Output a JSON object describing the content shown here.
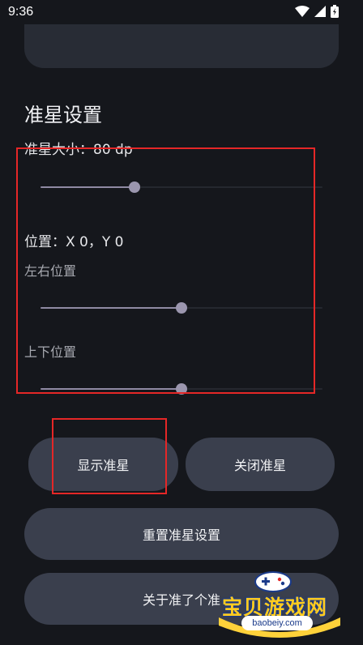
{
  "status_bar": {
    "time": "9:36",
    "icons": [
      "wifi-icon",
      "signal-icon",
      "battery-icon"
    ]
  },
  "section": {
    "title": "准星设置"
  },
  "crosshair_size": {
    "label": "准星大小：80 dp",
    "value_fraction": 0.33
  },
  "position": {
    "label": "位置：X 0，Y 0",
    "horizontal": {
      "label": "左右位置",
      "value_fraction": 0.5
    },
    "vertical": {
      "label": "上下位置",
      "value_fraction": 0.5
    }
  },
  "buttons": {
    "show": "显示准星",
    "close": "关闭准星",
    "reset": "重置准星设置",
    "about": "关于准了个准"
  },
  "watermark": {
    "name": "宝贝游戏网",
    "url": "baobeiy.com"
  },
  "colors": {
    "background": "#15171c",
    "button": "#3a3f4d",
    "slider_active": "#8f8aa3",
    "annotation": "#e52727"
  }
}
